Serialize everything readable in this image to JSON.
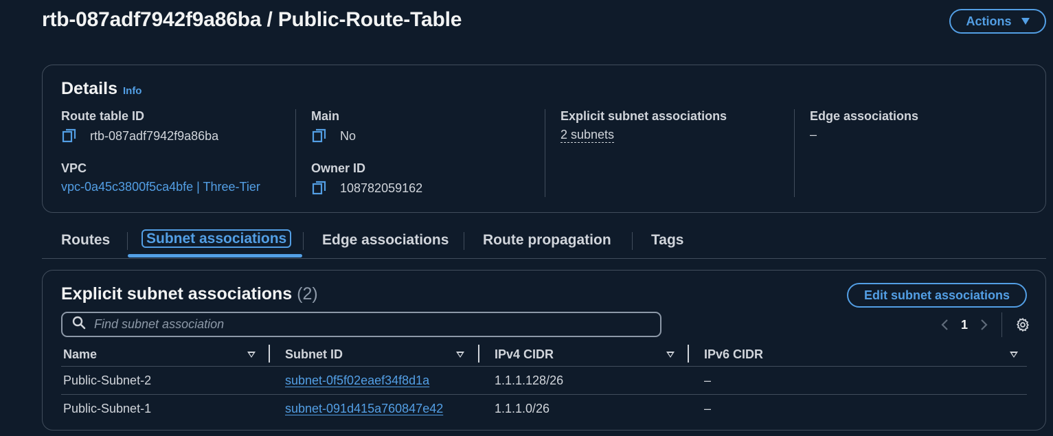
{
  "header": {
    "title": "rtb-087adf7942f9a86ba / Public-Route-Table",
    "actions_label": "Actions"
  },
  "details": {
    "title": "Details",
    "info_label": "Info",
    "route_table_id_label": "Route table ID",
    "route_table_id": "rtb-087adf7942f9a86ba",
    "vpc_label": "VPC",
    "vpc_value": "vpc-0a45c3800f5ca4bfe | Three-Tier",
    "main_label": "Main",
    "main_value": "No",
    "owner_id_label": "Owner ID",
    "owner_id_value": "108782059162",
    "explicit_label": "Explicit subnet associations",
    "explicit_value": "2 subnets",
    "edge_label": "Edge associations",
    "edge_value": "–"
  },
  "tabs": [
    {
      "label": "Routes"
    },
    {
      "label": "Subnet associations",
      "active": true
    },
    {
      "label": "Edge associations"
    },
    {
      "label": "Route propagation"
    },
    {
      "label": "Tags"
    }
  ],
  "associations": {
    "title": "Explicit subnet associations",
    "count": "(2)",
    "edit_label": "Edit subnet associations",
    "search_placeholder": "Find subnet association",
    "page": "1",
    "columns": [
      "Name",
      "Subnet ID",
      "IPv4 CIDR",
      "IPv6 CIDR"
    ],
    "rows": [
      {
        "name": "Public-Subnet-2",
        "subnet_id": "subnet-0f5f02eaef34f8d1a",
        "ipv4": "1.1.1.128/26",
        "ipv6": "–"
      },
      {
        "name": "Public-Subnet-1",
        "subnet_id": "subnet-091d415a760847e42",
        "ipv4": "1.1.1.0/26",
        "ipv6": "–"
      }
    ]
  },
  "colors": {
    "background": "#0f1b2a",
    "accent": "#539fe5",
    "border": "#414d5c",
    "text": "#d1d5db"
  },
  "icons": [
    "copy-icon",
    "search-icon",
    "chevron-left-icon",
    "chevron-right-icon",
    "settings-gear-icon",
    "caret-down-icon",
    "sort-caret-icon"
  ]
}
